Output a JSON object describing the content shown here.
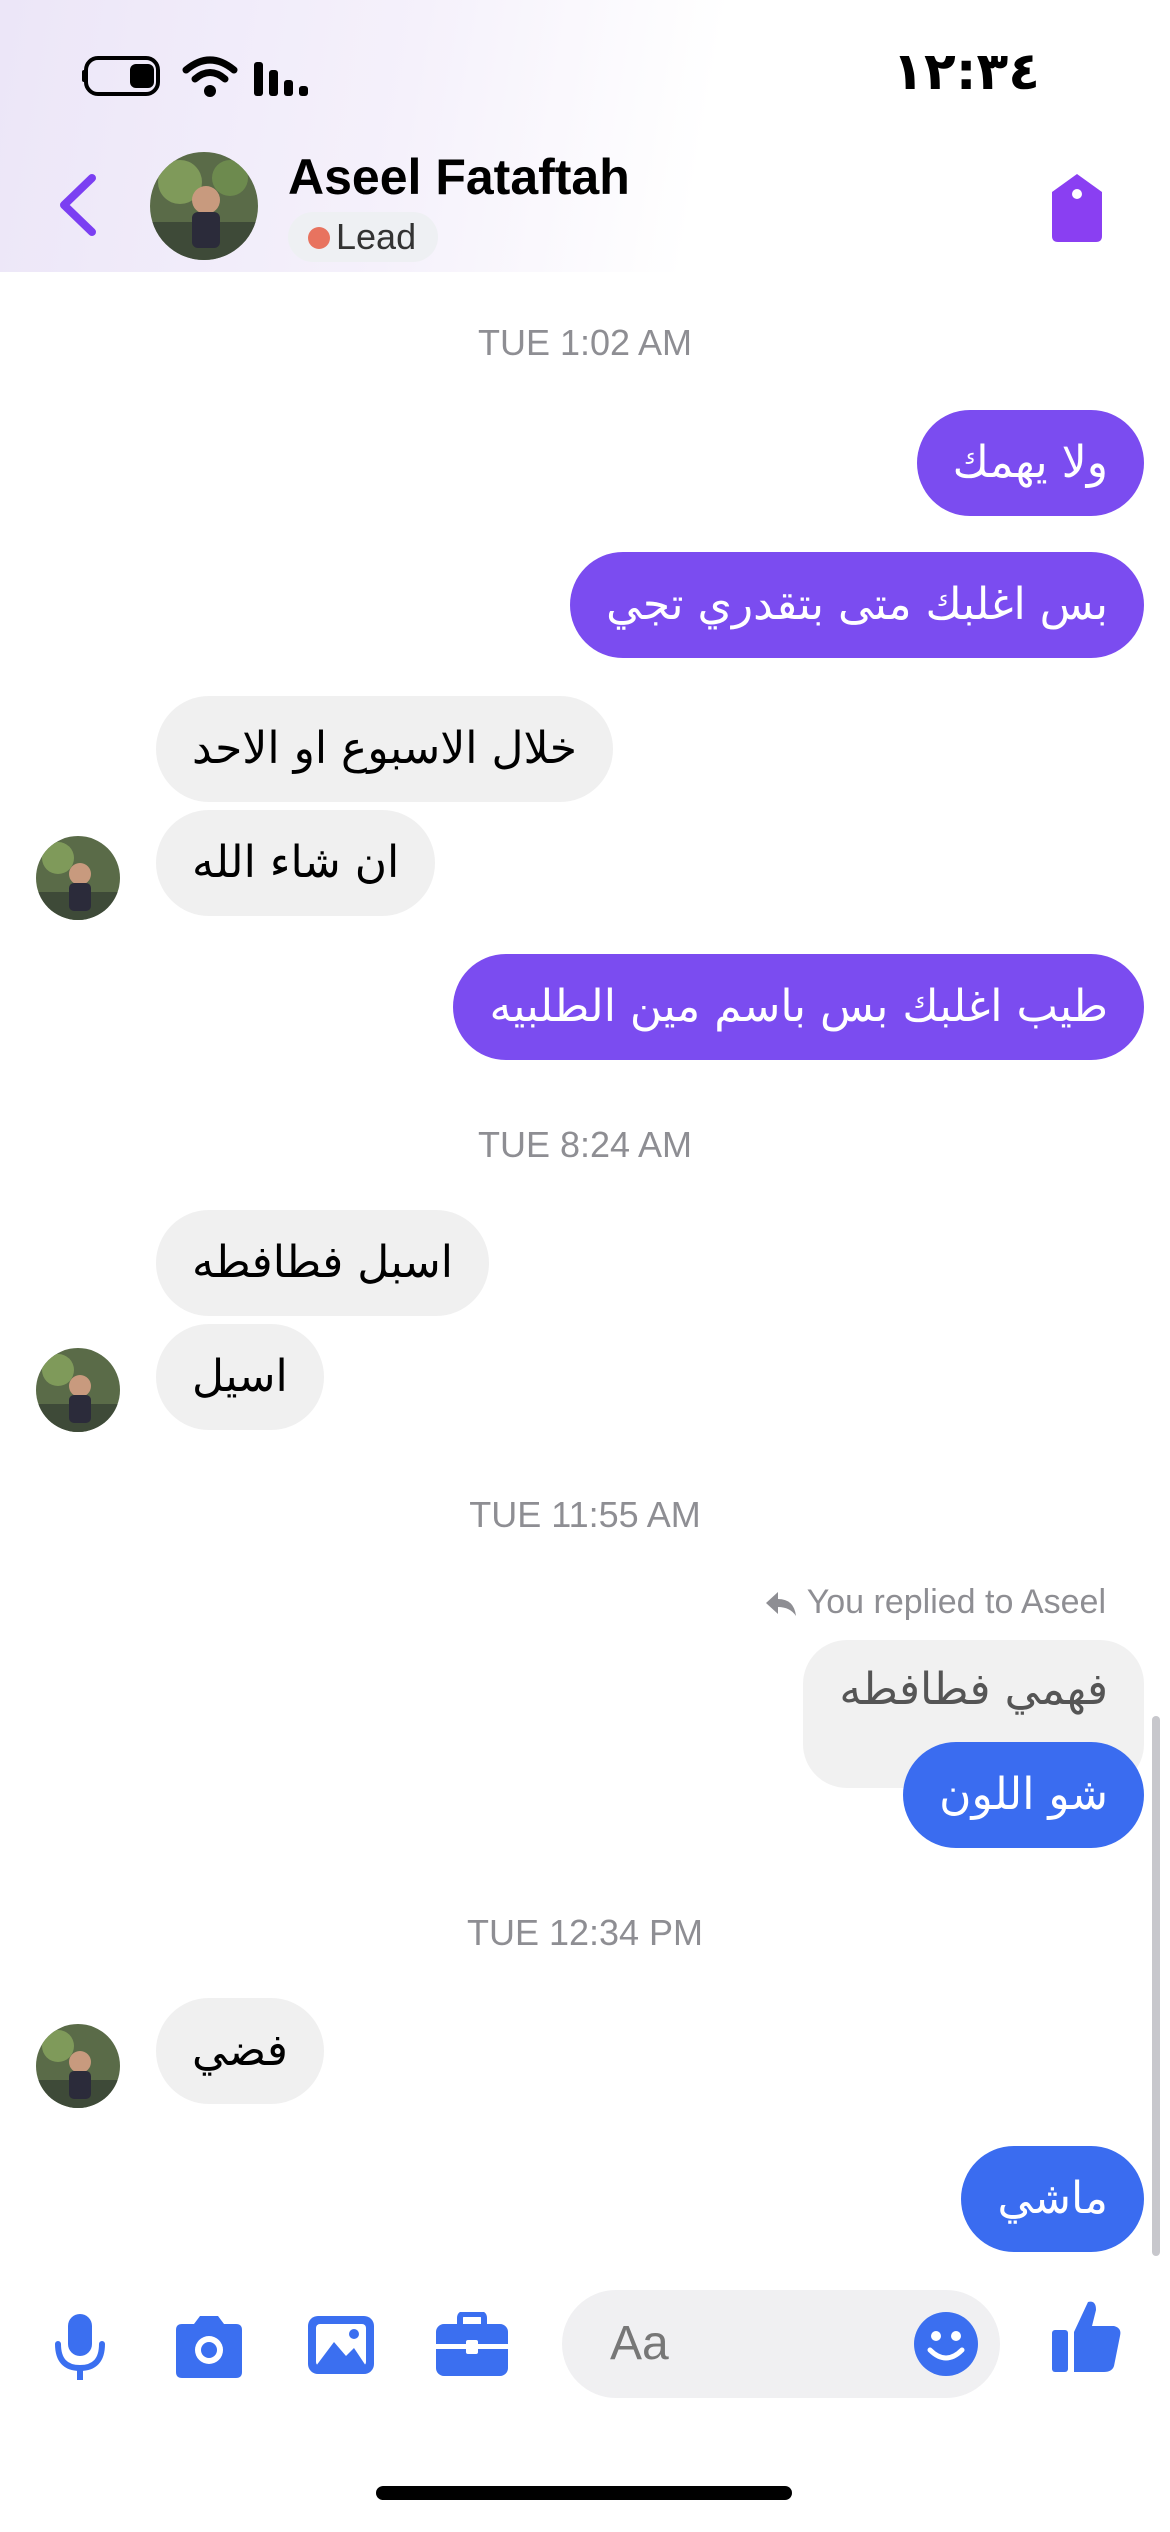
{
  "status_bar": {
    "time": "١٢:٣٤"
  },
  "header": {
    "contact_name": "Aseel Fataftah",
    "badge": "Lead",
    "icons": [
      "back-chevron-icon",
      "tag-icon"
    ],
    "accent": "#7b3ff2"
  },
  "timestamps": [
    "TUE 1:02 AM",
    "TUE 8:24 AM",
    "TUE 11:55 AM",
    "TUE 12:34 PM"
  ],
  "messages": {
    "m1": "ولا يهمك",
    "m2": "بس اغلبك  متى بتقدري تجي",
    "m3": "خلال الاسبوع  او الاحد",
    "m4": "ان شاء الله",
    "m5": "طيب اغلبك بس باسم مين الطلبيه",
    "m6": "اسبل فطافطه",
    "m7": "اسيل",
    "m8_quoted": "فهمي فطافطه",
    "m9": "شو اللون",
    "m10": "فضي",
    "m11": "ماشي"
  },
  "reply_note": "You replied to Aseel",
  "composer": {
    "placeholder": "Aa",
    "icons": [
      "microphone-icon",
      "camera-icon",
      "gallery-icon",
      "briefcase-icon",
      "emoji-icon",
      "thumbs-up-icon"
    ]
  },
  "colors": {
    "outgoing_purple": "#7b4cf0",
    "outgoing_blue": "#3a6cf0",
    "incoming": "#f0f0f0",
    "toolbar_blue": "#3b6ff0"
  }
}
